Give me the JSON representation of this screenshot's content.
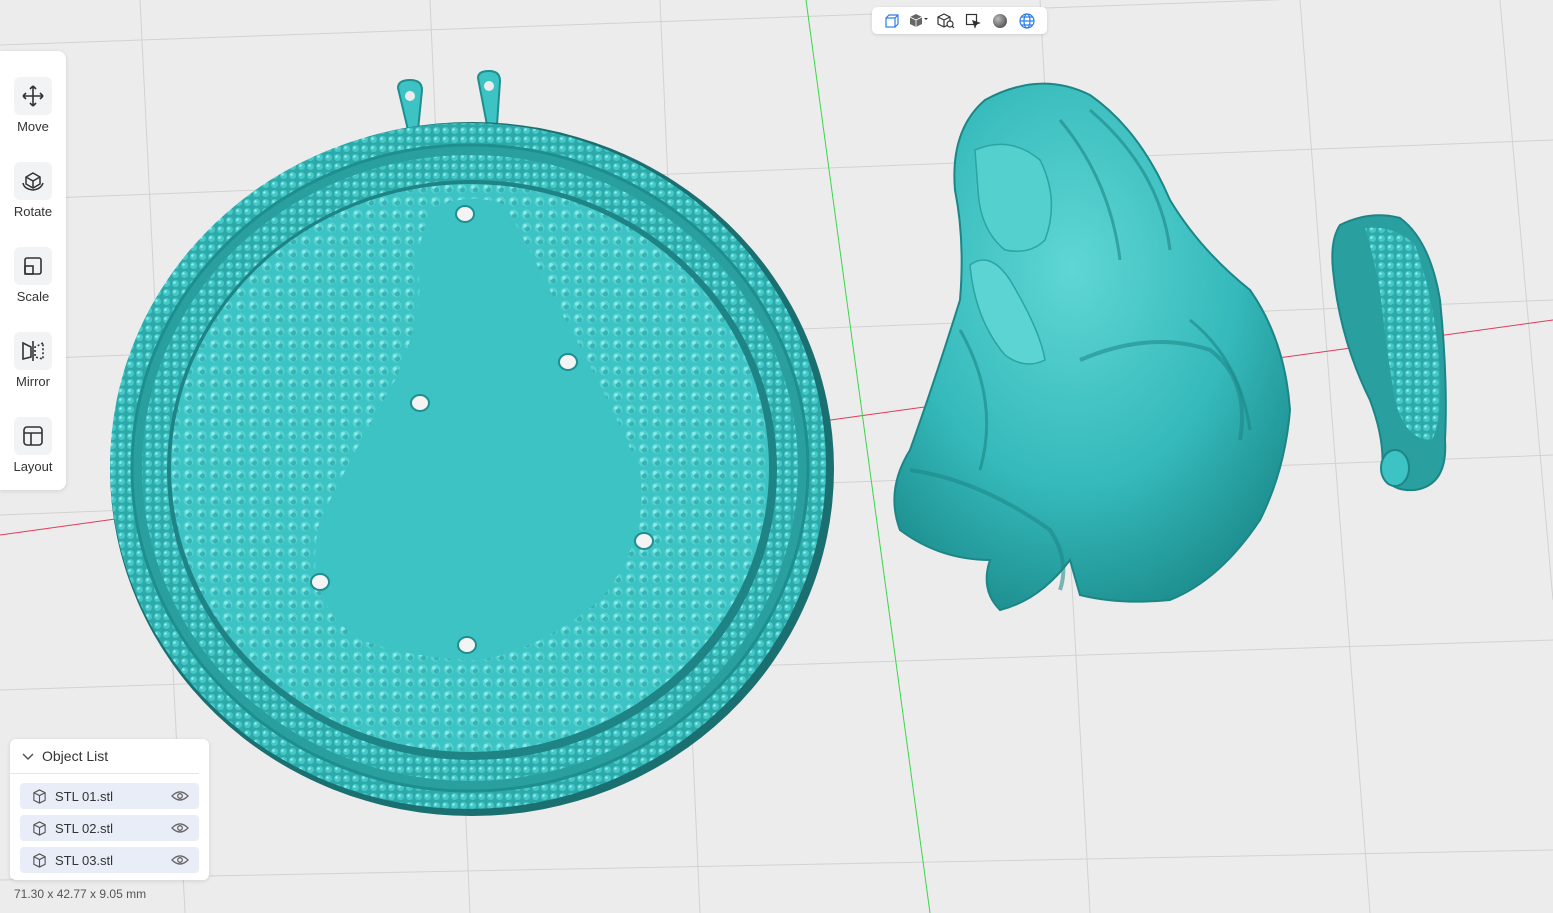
{
  "toolbar": {
    "tools": [
      {
        "label": "Move",
        "icon": "move-icon"
      },
      {
        "label": "Rotate",
        "icon": "rotate-icon"
      },
      {
        "label": "Scale",
        "icon": "scale-icon"
      },
      {
        "label": "Mirror",
        "icon": "mirror-icon"
      },
      {
        "label": "Layout",
        "icon": "layout-icon"
      }
    ]
  },
  "view_toolbar": {
    "buttons": [
      "perspective-view-icon",
      "view-cube-dropdown-icon",
      "fit-view-icon",
      "select-area-icon",
      "solid-shading-icon",
      "wireframe-shading-icon"
    ]
  },
  "object_list": {
    "title": "Object List",
    "items": [
      {
        "name": "STL 01.stl"
      },
      {
        "name": "STL 02.stl"
      },
      {
        "name": "STL 03.stl"
      }
    ]
  },
  "status": {
    "dimensions": "71.30 x 42.77 x 9.05 mm"
  },
  "colors": {
    "model": "#3ec3c4",
    "model_dark": "#1f8e8f",
    "x_axis": "#e23b5a",
    "y_axis": "#3ad64a",
    "grid_bg": "#ececec"
  }
}
